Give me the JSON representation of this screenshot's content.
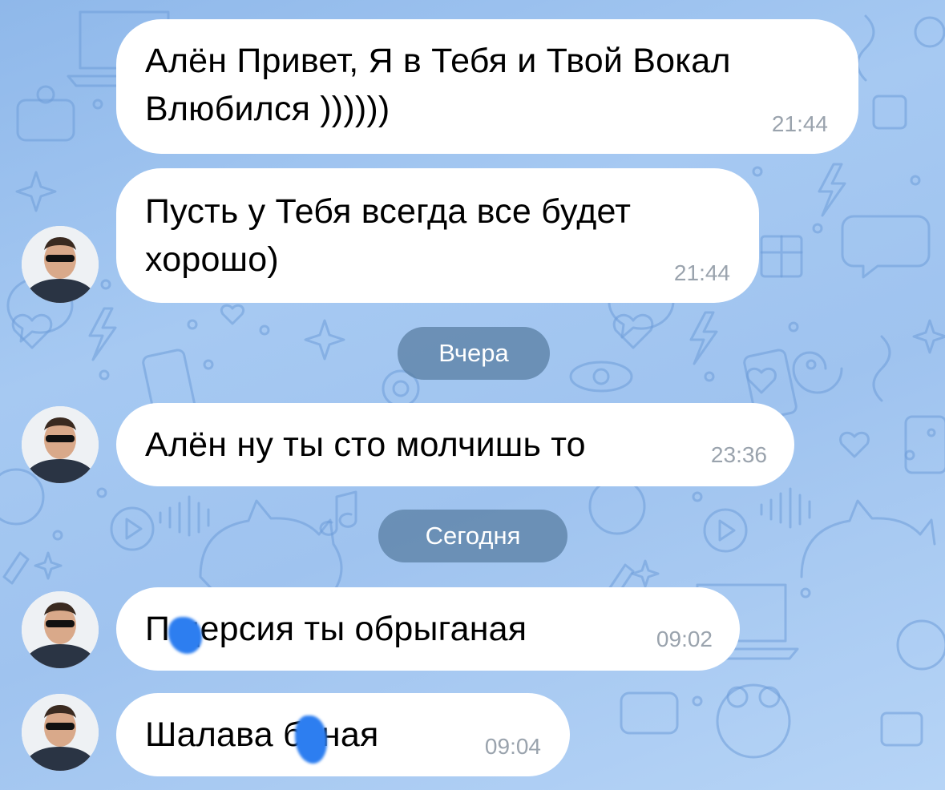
{
  "chat": {
    "messages": [
      {
        "text": "Алён Привет, Я в Тебя и Твой Вокал\nВлюбился ))))))",
        "time": "21:44"
      },
      {
        "text": "Пусть у Тебя всегда все будет\nхорошо)",
        "time": "21:44"
      },
      {
        "text": "Алён ну ты сто молчишь то",
        "time": "23:36"
      },
      {
        "text": "П  дерсия ты обрыганая",
        "time": "09:02"
      },
      {
        "text": "Шалава   баная",
        "time": "09:04"
      }
    ],
    "date_separators": {
      "yesterday": "Вчера",
      "today": "Сегодня"
    }
  },
  "icons": {
    "avatar": "user-photo-avatar",
    "wallpaper": "doodle-pattern"
  },
  "colors": {
    "bubble": "#ffffff",
    "time": "#9aa3ad",
    "pill": "#567ca0",
    "background": "#9fc3ef",
    "censor": "#2d7ef0"
  }
}
